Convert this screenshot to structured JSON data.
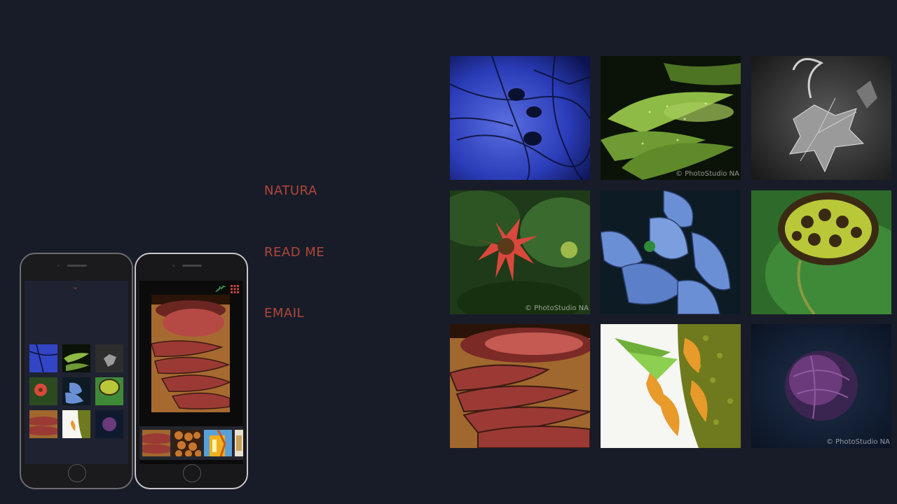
{
  "nav": {
    "items": [
      {
        "label": "NATURA"
      },
      {
        "label": "READ ME"
      },
      {
        "label": "EMAIL"
      }
    ]
  },
  "gallery": {
    "watermark": "© PhotoStudio NA",
    "tiles": [
      {
        "name": "blue-branches-photo"
      },
      {
        "name": "green-leaves-photo"
      },
      {
        "name": "monochrome-leaf-photo"
      },
      {
        "name": "red-dahlia-photo"
      },
      {
        "name": "blue-flower-photo"
      },
      {
        "name": "lotus-seedpod-photo"
      },
      {
        "name": "roast-beef-photo"
      },
      {
        "name": "sunflower-petals-photo"
      },
      {
        "name": "purple-cabbage-photo"
      }
    ]
  },
  "phone_left": {
    "chevron_icon": "chevron-down-icon"
  },
  "phone_right": {
    "icons": [
      "leaf-logo-icon",
      "grid-icon"
    ]
  },
  "colors": {
    "background": "#181c28",
    "accent": "#b0463a"
  }
}
